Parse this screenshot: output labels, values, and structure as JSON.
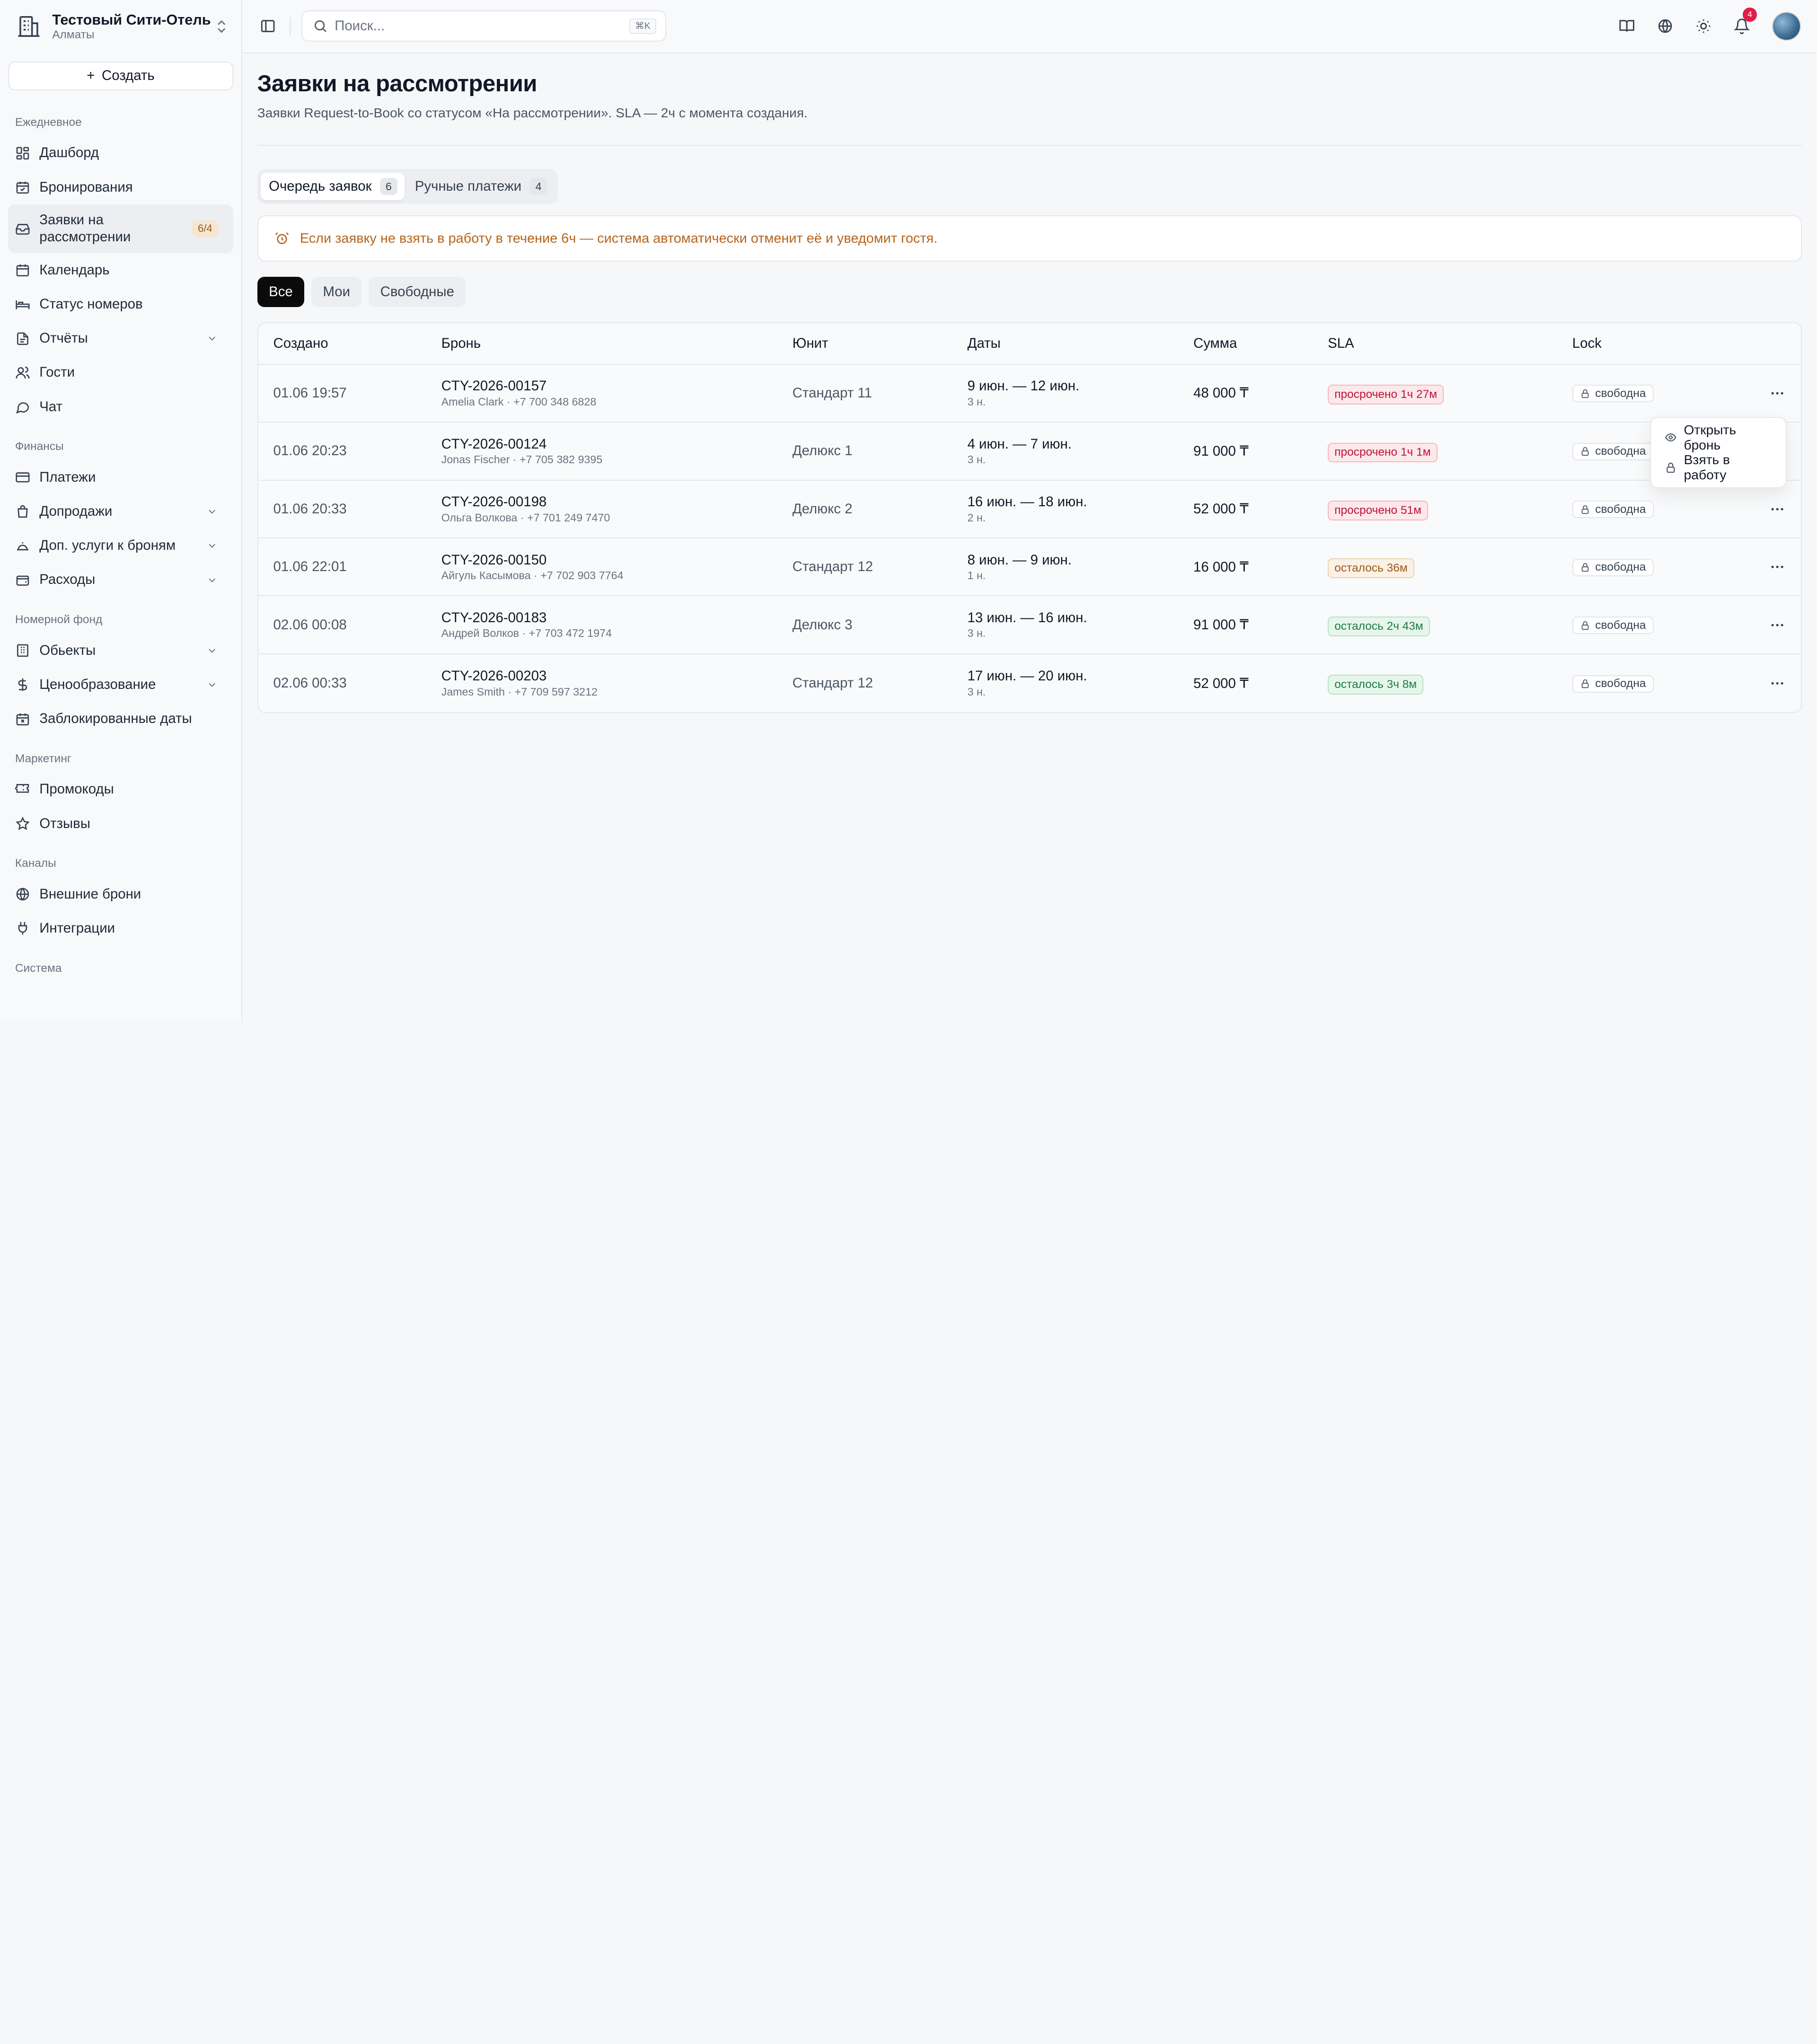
{
  "hotel": {
    "name": "Тестовый Сити-Отель",
    "city": "Алматы"
  },
  "sidebar": {
    "create_label": "Создать",
    "sections": [
      {
        "label": "Ежедневное",
        "items": [
          {
            "label": "Дашборд",
            "icon": "dashboard-icon"
          },
          {
            "label": "Бронирования",
            "icon": "calendar-check-icon"
          },
          {
            "label": "Заявки на рассмотрении",
            "icon": "inbox-icon",
            "badge": "6/4",
            "active": true
          },
          {
            "label": "Календарь",
            "icon": "calendar-icon"
          },
          {
            "label": "Статус номеров",
            "icon": "bed-icon"
          },
          {
            "label": "Отчёты",
            "icon": "file-icon",
            "expandable": true
          },
          {
            "label": "Гости",
            "icon": "users-icon"
          },
          {
            "label": "Чат",
            "icon": "chat-icon"
          }
        ]
      },
      {
        "label": "Финансы",
        "items": [
          {
            "label": "Платежи",
            "icon": "credit-card-icon"
          },
          {
            "label": "Допродажи",
            "icon": "bag-icon",
            "expandable": true
          },
          {
            "label": "Доп. услуги к броням",
            "icon": "bell-service-icon",
            "expandable": true
          },
          {
            "label": "Расходы",
            "icon": "wallet-icon",
            "expandable": true
          }
        ]
      },
      {
        "label": "Номерной фонд",
        "items": [
          {
            "label": "Обьекты",
            "icon": "building-icon",
            "expandable": true
          },
          {
            "label": "Ценообразование",
            "icon": "dollar-icon",
            "expandable": true
          },
          {
            "label": "Заблокированные даты",
            "icon": "calendar-x-icon"
          }
        ]
      },
      {
        "label": "Маркетинг",
        "items": [
          {
            "label": "Промокоды",
            "icon": "ticket-icon"
          },
          {
            "label": "Отзывы",
            "icon": "star-icon"
          }
        ]
      },
      {
        "label": "Каналы",
        "items": [
          {
            "label": "Внешние брони",
            "icon": "globe-icon"
          },
          {
            "label": "Интеграции",
            "icon": "plug-icon"
          }
        ]
      },
      {
        "label": "Система",
        "items": []
      }
    ]
  },
  "topbar": {
    "search_placeholder": "Поиск...",
    "search_shortcut": "⌘K",
    "notifications_count": "4"
  },
  "page": {
    "title": "Заявки на рассмотрении",
    "subtitle": "Заявки Request-to-Book со статусом «На рассмотрении». SLA — 2ч с момента создания.",
    "tabs": [
      {
        "label": "Очередь заявок",
        "count": "6",
        "active": true
      },
      {
        "label": "Ручные платежи",
        "count": "4",
        "active": false
      }
    ],
    "alert": "Если заявку не взять в работу в течение 6ч — система автоматически отменит её и уведомит гостя.",
    "filters": [
      {
        "label": "Все",
        "active": true
      },
      {
        "label": "Мои",
        "active": false
      },
      {
        "label": "Свободные",
        "active": false
      }
    ]
  },
  "table": {
    "columns": [
      "Создано",
      "Бронь",
      "Юнит",
      "Даты",
      "Сумма",
      "SLA",
      "Lock"
    ],
    "rows": [
      {
        "created": "01.06 19:57",
        "code": "CTY-2026-00157",
        "guest": "Amelia Clark · +7 700 348 6828",
        "unit": "Стандарт 11",
        "dates": "9 июн. — 12 июн.",
        "nights": "3 н.",
        "sum": "48 000 ₸",
        "sla": "просрочено 1ч 27м",
        "sla_state": "over",
        "lock": "свободна"
      },
      {
        "created": "01.06 20:23",
        "code": "CTY-2026-00124",
        "guest": "Jonas Fischer · +7 705 382 9395",
        "unit": "Делюкс 1",
        "dates": "4 июн. — 7 июн.",
        "nights": "3 н.",
        "sum": "91 000 ₸",
        "sla": "просрочено 1ч 1м",
        "sla_state": "over",
        "lock": "свободна"
      },
      {
        "created": "01.06 20:33",
        "code": "CTY-2026-00198",
        "guest": "Ольга Волкова · +7 701 249 7470",
        "unit": "Делюкс 2",
        "dates": "16 июн. — 18 июн.",
        "nights": "2 н.",
        "sum": "52 000 ₸",
        "sla": "просрочено 51м",
        "sla_state": "over",
        "lock": "свободна"
      },
      {
        "created": "01.06 22:01",
        "code": "CTY-2026-00150",
        "guest": "Айгуль Касымова · +7 702 903 7764",
        "unit": "Стандарт 12",
        "dates": "8 июн. — 9 июн.",
        "nights": "1 н.",
        "sum": "16 000 ₸",
        "sla": "осталось 36м",
        "sla_state": "warn",
        "lock": "свободна"
      },
      {
        "created": "02.06 00:08",
        "code": "CTY-2026-00183",
        "guest": "Андрей Волков · +7 703 472 1974",
        "unit": "Делюкс 3",
        "dates": "13 июн. — 16 июн.",
        "nights": "3 н.",
        "sum": "91 000 ₸",
        "sla": "осталось 2ч 43м",
        "sla_state": "ok",
        "lock": "свободна"
      },
      {
        "created": "02.06 00:33",
        "code": "CTY-2026-00203",
        "guest": "James Smith · +7 709 597 3212",
        "unit": "Стандарт 12",
        "dates": "17 июн. — 20 июн.",
        "nights": "3 н.",
        "sum": "52 000 ₸",
        "sla": "осталось 3ч 8м",
        "sla_state": "ok",
        "lock": "свободна"
      }
    ]
  },
  "row_menu": {
    "open_label": "Открыть бронь",
    "take_label": "Взять в работу"
  }
}
